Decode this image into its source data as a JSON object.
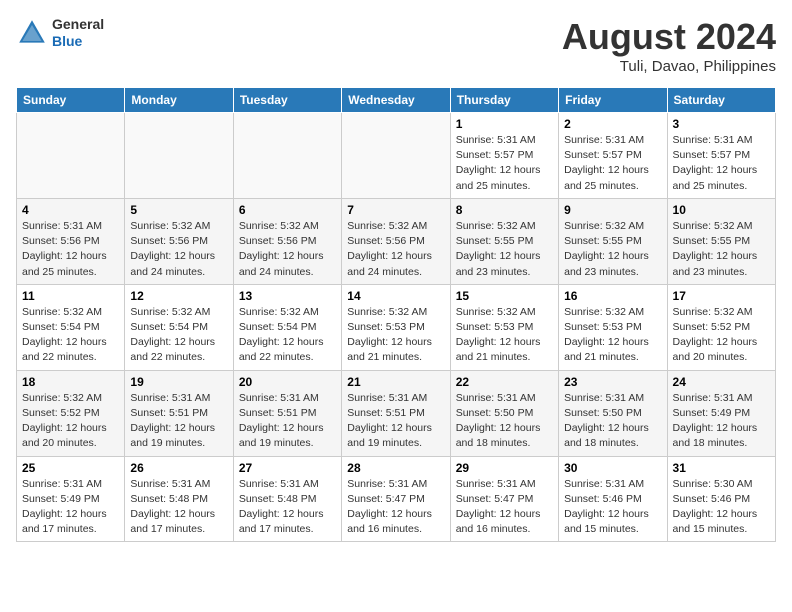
{
  "header": {
    "logo_line1": "General",
    "logo_line2": "Blue",
    "month_year": "August 2024",
    "location": "Tuli, Davao, Philippines"
  },
  "days_of_week": [
    "Sunday",
    "Monday",
    "Tuesday",
    "Wednesday",
    "Thursday",
    "Friday",
    "Saturday"
  ],
  "weeks": [
    [
      {
        "day": "",
        "info": ""
      },
      {
        "day": "",
        "info": ""
      },
      {
        "day": "",
        "info": ""
      },
      {
        "day": "",
        "info": ""
      },
      {
        "day": "1",
        "info": "Sunrise: 5:31 AM\nSunset: 5:57 PM\nDaylight: 12 hours\nand 25 minutes."
      },
      {
        "day": "2",
        "info": "Sunrise: 5:31 AM\nSunset: 5:57 PM\nDaylight: 12 hours\nand 25 minutes."
      },
      {
        "day": "3",
        "info": "Sunrise: 5:31 AM\nSunset: 5:57 PM\nDaylight: 12 hours\nand 25 minutes."
      }
    ],
    [
      {
        "day": "4",
        "info": "Sunrise: 5:31 AM\nSunset: 5:56 PM\nDaylight: 12 hours\nand 25 minutes."
      },
      {
        "day": "5",
        "info": "Sunrise: 5:32 AM\nSunset: 5:56 PM\nDaylight: 12 hours\nand 24 minutes."
      },
      {
        "day": "6",
        "info": "Sunrise: 5:32 AM\nSunset: 5:56 PM\nDaylight: 12 hours\nand 24 minutes."
      },
      {
        "day": "7",
        "info": "Sunrise: 5:32 AM\nSunset: 5:56 PM\nDaylight: 12 hours\nand 24 minutes."
      },
      {
        "day": "8",
        "info": "Sunrise: 5:32 AM\nSunset: 5:55 PM\nDaylight: 12 hours\nand 23 minutes."
      },
      {
        "day": "9",
        "info": "Sunrise: 5:32 AM\nSunset: 5:55 PM\nDaylight: 12 hours\nand 23 minutes."
      },
      {
        "day": "10",
        "info": "Sunrise: 5:32 AM\nSunset: 5:55 PM\nDaylight: 12 hours\nand 23 minutes."
      }
    ],
    [
      {
        "day": "11",
        "info": "Sunrise: 5:32 AM\nSunset: 5:54 PM\nDaylight: 12 hours\nand 22 minutes."
      },
      {
        "day": "12",
        "info": "Sunrise: 5:32 AM\nSunset: 5:54 PM\nDaylight: 12 hours\nand 22 minutes."
      },
      {
        "day": "13",
        "info": "Sunrise: 5:32 AM\nSunset: 5:54 PM\nDaylight: 12 hours\nand 22 minutes."
      },
      {
        "day": "14",
        "info": "Sunrise: 5:32 AM\nSunset: 5:53 PM\nDaylight: 12 hours\nand 21 minutes."
      },
      {
        "day": "15",
        "info": "Sunrise: 5:32 AM\nSunset: 5:53 PM\nDaylight: 12 hours\nand 21 minutes."
      },
      {
        "day": "16",
        "info": "Sunrise: 5:32 AM\nSunset: 5:53 PM\nDaylight: 12 hours\nand 21 minutes."
      },
      {
        "day": "17",
        "info": "Sunrise: 5:32 AM\nSunset: 5:52 PM\nDaylight: 12 hours\nand 20 minutes."
      }
    ],
    [
      {
        "day": "18",
        "info": "Sunrise: 5:32 AM\nSunset: 5:52 PM\nDaylight: 12 hours\nand 20 minutes."
      },
      {
        "day": "19",
        "info": "Sunrise: 5:31 AM\nSunset: 5:51 PM\nDaylight: 12 hours\nand 19 minutes."
      },
      {
        "day": "20",
        "info": "Sunrise: 5:31 AM\nSunset: 5:51 PM\nDaylight: 12 hours\nand 19 minutes."
      },
      {
        "day": "21",
        "info": "Sunrise: 5:31 AM\nSunset: 5:51 PM\nDaylight: 12 hours\nand 19 minutes."
      },
      {
        "day": "22",
        "info": "Sunrise: 5:31 AM\nSunset: 5:50 PM\nDaylight: 12 hours\nand 18 minutes."
      },
      {
        "day": "23",
        "info": "Sunrise: 5:31 AM\nSunset: 5:50 PM\nDaylight: 12 hours\nand 18 minutes."
      },
      {
        "day": "24",
        "info": "Sunrise: 5:31 AM\nSunset: 5:49 PM\nDaylight: 12 hours\nand 18 minutes."
      }
    ],
    [
      {
        "day": "25",
        "info": "Sunrise: 5:31 AM\nSunset: 5:49 PM\nDaylight: 12 hours\nand 17 minutes."
      },
      {
        "day": "26",
        "info": "Sunrise: 5:31 AM\nSunset: 5:48 PM\nDaylight: 12 hours\nand 17 minutes."
      },
      {
        "day": "27",
        "info": "Sunrise: 5:31 AM\nSunset: 5:48 PM\nDaylight: 12 hours\nand 17 minutes."
      },
      {
        "day": "28",
        "info": "Sunrise: 5:31 AM\nSunset: 5:47 PM\nDaylight: 12 hours\nand 16 minutes."
      },
      {
        "day": "29",
        "info": "Sunrise: 5:31 AM\nSunset: 5:47 PM\nDaylight: 12 hours\nand 16 minutes."
      },
      {
        "day": "30",
        "info": "Sunrise: 5:31 AM\nSunset: 5:46 PM\nDaylight: 12 hours\nand 15 minutes."
      },
      {
        "day": "31",
        "info": "Sunrise: 5:30 AM\nSunset: 5:46 PM\nDaylight: 12 hours\nand 15 minutes."
      }
    ]
  ]
}
